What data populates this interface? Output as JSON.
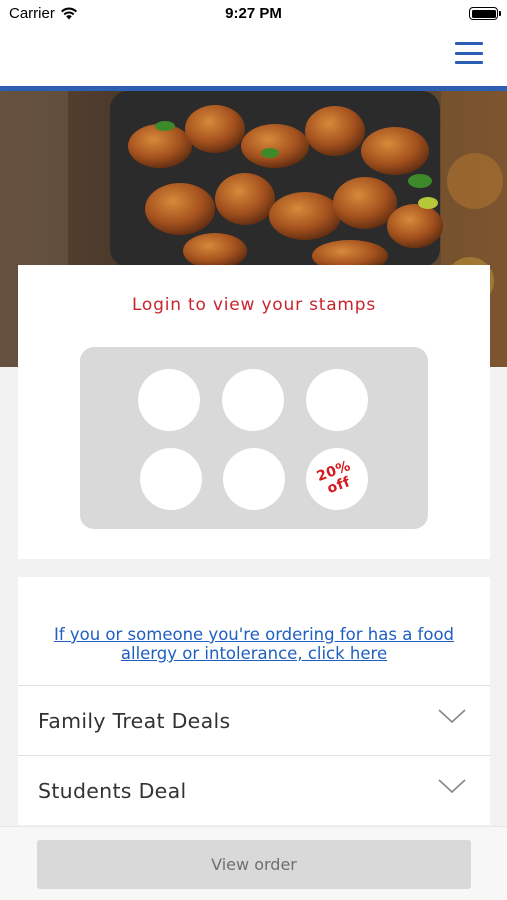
{
  "status_bar": {
    "carrier": "Carrier",
    "time": "9:27 PM"
  },
  "header": {
    "menu_icon": "hamburger-menu-icon",
    "accent_color": "#2f5fb0"
  },
  "hero": {
    "image": "grilled-chicken-wings-photo"
  },
  "stamps": {
    "title": "Login to view your stamps",
    "reward_line1": "20%",
    "reward_line2": "off",
    "empty_count": 5,
    "accent_color": "#c8252d"
  },
  "allergy": {
    "link_text": "If you or someone you're ordering for has a food allergy or intolerance, click here"
  },
  "menu": {
    "sections": [
      {
        "label": "Family Treat Deals"
      },
      {
        "label": "Students Deal"
      }
    ]
  },
  "footer": {
    "view_order_label": "View order"
  }
}
